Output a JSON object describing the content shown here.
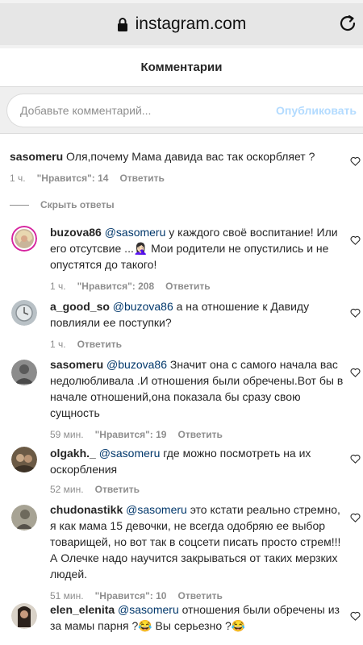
{
  "browser": {
    "url": "instagram.com"
  },
  "header": {
    "title": "Комментарии"
  },
  "composer": {
    "placeholder": "Добавьте комментарий...",
    "publish_label": "Опубликовать"
  },
  "root_comment": {
    "username": "sasomeru",
    "text": " Оля,почему Мама давида вас так оскорбляет ?",
    "time": "1 ч.",
    "likes": "\"Нравится\": 14",
    "reply": "Ответить"
  },
  "hide_replies_label": "Скрыть ответы",
  "replies": [
    {
      "username": "buzova86",
      "mention": "@sasomeru",
      "line1": " у каждого своё воспитание! Или",
      "line2": "его отсутсвие ...🤦🏻‍♀️ Мои родители не опустились и не",
      "line3": "опустятся до такого!",
      "time": "1 ч.",
      "likes": "\"Нравится\": 208",
      "reply": "Ответить"
    },
    {
      "username": "a_good_so",
      "mention": "@buzova86",
      "line1": " а на отношение к Давиду",
      "line2": "повлияли ее поступки?",
      "time": "1 ч.",
      "reply": "Ответить"
    },
    {
      "username": "sasomeru",
      "mention": "@buzova86",
      "line1": " Значит она с самого начала вас",
      "line2": "недолюбливала .И отношения были обречены.Вот бы в",
      "line3": "начале отношений,она показала бы сразу свою",
      "line4": "сущность",
      "time": "59 мин.",
      "likes": "\"Нравится\": 19",
      "reply": "Ответить"
    },
    {
      "username": "olgakh._",
      "mention": "@sasomeru",
      "line1": " где можно посмотреть на их",
      "line2": "оскорбления",
      "time": "52 мин.",
      "reply": "Ответить"
    },
    {
      "username": "chudonastikk",
      "mention": "@sasomeru",
      "line1": " это кстати реально стремно,",
      "line2": "я как мама 15 девочки, не всегда одобряю ее выбор",
      "line3": "товарищей, но вот так в соцсети писать просто стрем!!!",
      "line4": "А Олечке надо научится закрываться от таких мерзких",
      "line5": "людей.",
      "time": "51 мин.",
      "likes": "\"Нравится\": 10",
      "reply": "Ответить"
    },
    {
      "username": "elen_elenita",
      "mention": "@sasomeru",
      "line1": " отношения были обречены из",
      "line2": "за мамы парня ?😂 Вы серьезно ?😂"
    }
  ],
  "icons": {
    "lock": "lock-icon",
    "reload": "reload-icon",
    "heart": "heart-outline-icon"
  },
  "colors": {
    "mention": "#00376b",
    "muted": "#8e8e8e",
    "publish_disabled": "#b3dbff",
    "story_ring": "#d6249f"
  }
}
